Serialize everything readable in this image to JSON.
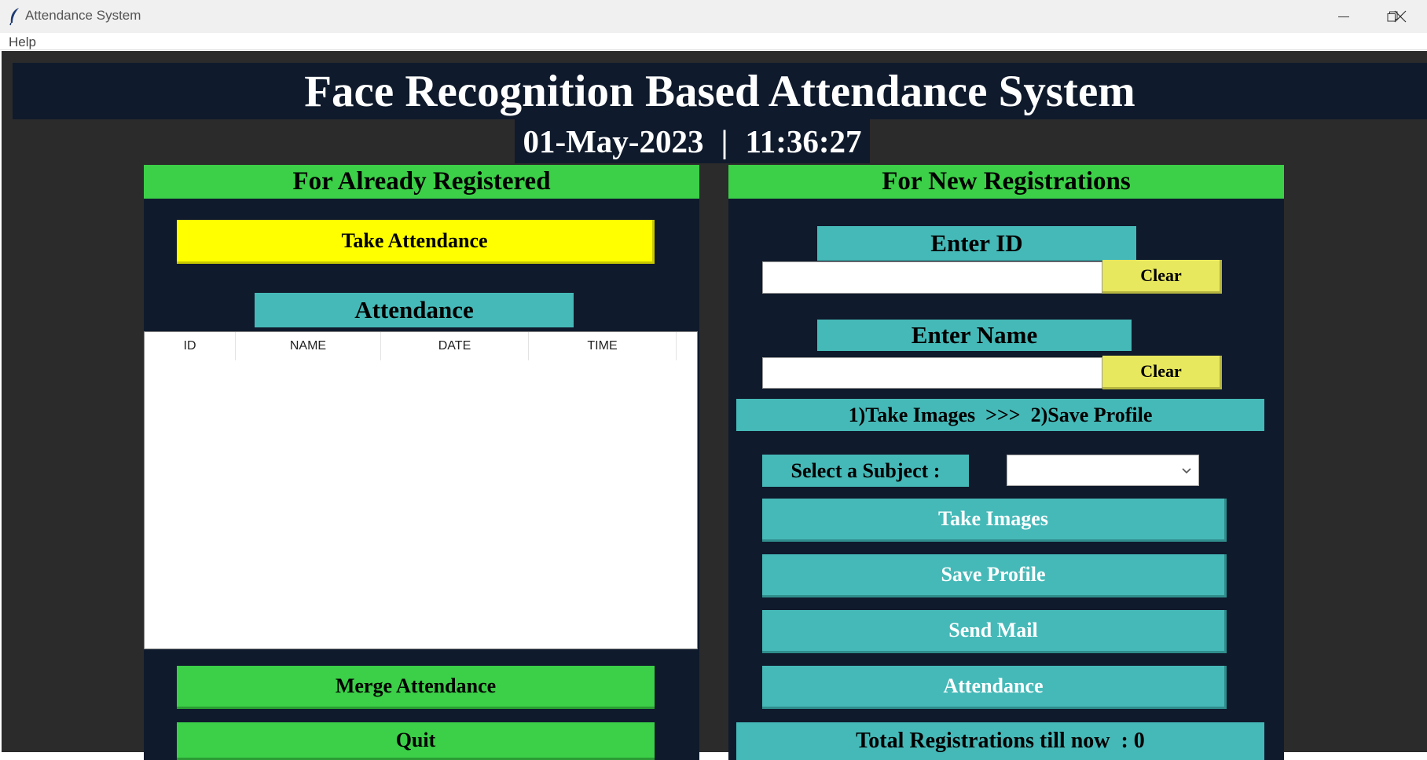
{
  "window": {
    "title": "Attendance System",
    "menu": [
      "Help"
    ],
    "controls": [
      "minimize-icon",
      "restore-icon",
      "close-icon"
    ]
  },
  "header": {
    "title": "Face Recognition Based Attendance System",
    "date": "01-May-2023",
    "separator": "|",
    "time": "11:36:27"
  },
  "left_panel": {
    "title": "For Already Registered",
    "take_attendance_label": "Take Attendance",
    "attendance_label": "Attendance",
    "table": {
      "columns": [
        "ID",
        "NAME",
        "DATE",
        "TIME"
      ],
      "rows": []
    },
    "merge_label": "Merge Attendance",
    "quit_label": "Quit"
  },
  "right_panel": {
    "title": "For New Registrations",
    "enter_id_label": "Enter ID",
    "id_value": "",
    "clear_label": "Clear",
    "enter_name_label": "Enter Name",
    "name_value": "",
    "steps_text": "1)Take Images  >>>  2)Save Profile",
    "subject_label": "Select a Subject :",
    "subject_selected": "",
    "take_images_label": "Take Images",
    "save_profile_label": "Save Profile",
    "send_mail_label": "Send Mail",
    "attendance_label": "Attendance",
    "total_label": "Total Registrations till now  : 0"
  },
  "colors": {
    "dark_panel": "#0f1a2c",
    "background": "#2b2b2b",
    "green": "#3ccf48",
    "teal": "#45b9b8",
    "yellow": "#ffff00",
    "clear_yellow": "#e8e85e"
  }
}
